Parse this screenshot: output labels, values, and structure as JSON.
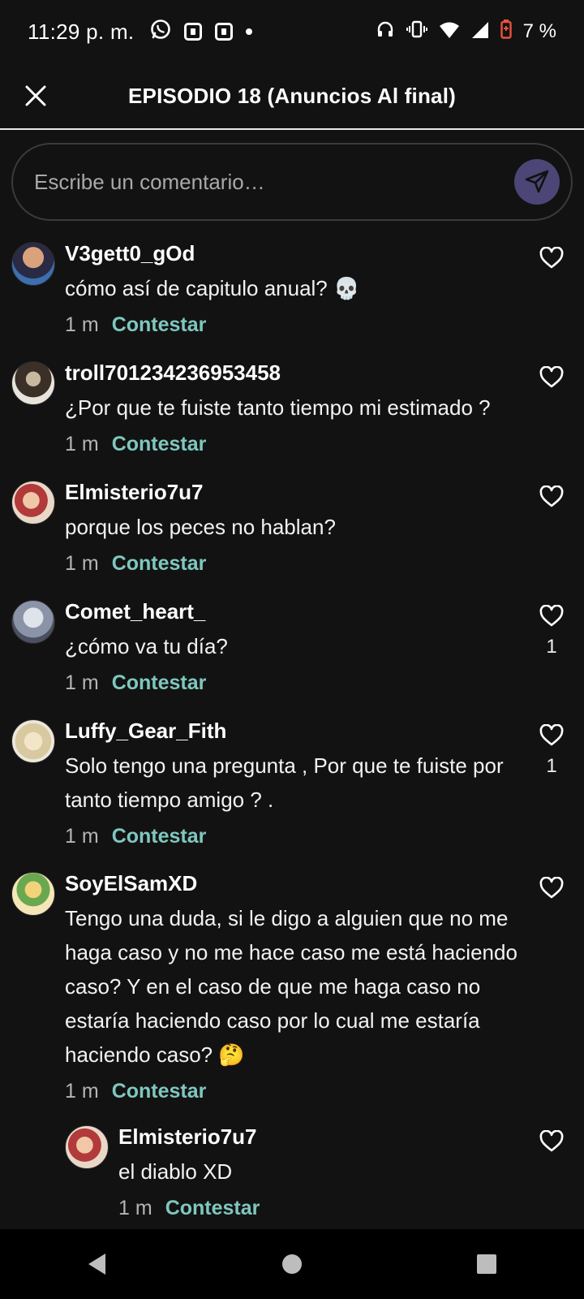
{
  "status_bar": {
    "time": "11:29 p. m.",
    "battery": "7 %",
    "battery_color": "#e8533f"
  },
  "header": {
    "title": "EPISODIO 18 (Anuncios Al final)"
  },
  "comment_input": {
    "placeholder": "Escribe un comentario…"
  },
  "colors": {
    "accent": "#7fc7bf",
    "send_bg": "#4b4676",
    "background": "#121212"
  },
  "comments": [
    {
      "username": "V3gett0_gOd",
      "text": "cómo así de capitulo anual? 💀",
      "time": "1 m",
      "reply_label": "Contestar",
      "likes": ""
    },
    {
      "username": "troll701234236953458",
      "text": "¿Por que te fuiste tanto tiempo mi estimado ?",
      "time": "1 m",
      "reply_label": "Contestar",
      "likes": ""
    },
    {
      "username": "Elmisterio7u7",
      "text": "porque los peces no hablan?",
      "time": "1 m",
      "reply_label": "Contestar",
      "likes": ""
    },
    {
      "username": "Comet_heart_",
      "text": "¿cómo va tu día?",
      "time": "1 m",
      "reply_label": "Contestar",
      "likes": "1"
    },
    {
      "username": "Luffy_Gear_Fith",
      "text": "Solo tengo una pregunta , Por que te fuiste por tanto tiempo amigo ? .",
      "time": "1 m",
      "reply_label": "Contestar",
      "likes": "1"
    },
    {
      "username": "SoyElSamXD",
      "text": "Tengo una duda, si le digo a alguien que no me haga caso y no me hace caso me está haciendo caso? Y en el caso de que me haga caso no estaría haciendo caso por lo cual me estaría haciendo caso? 🤔",
      "time": "1 m",
      "reply_label": "Contestar",
      "likes": ""
    },
    {
      "username": "Elmisterio7u7",
      "text": "el diablo XD",
      "time": "1 m",
      "reply_label": "Contestar",
      "likes": ""
    }
  ]
}
